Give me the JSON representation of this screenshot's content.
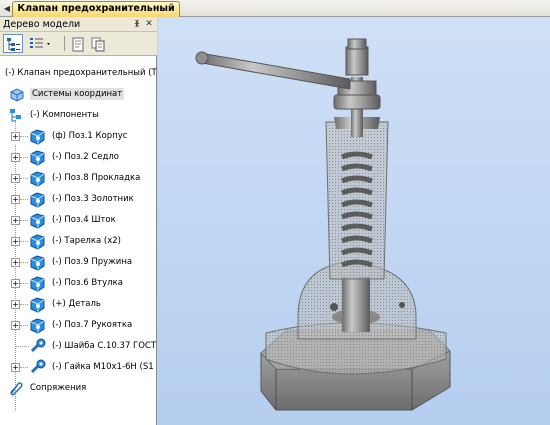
{
  "tabs": {
    "nav_icon": "chevron-left-icon",
    "document": "Клапан предохранительный"
  },
  "panel": {
    "title": "Дерево модели",
    "pin_icon": "pin-icon",
    "close_icon": "close-icon"
  },
  "tree": {
    "root": "(-) Клапан предохранительный (Т",
    "coord_systems": "Системы координат",
    "components": "(-) Компоненты",
    "items": [
      {
        "label": "(ф) Поз.1 Корпус",
        "type": "part"
      },
      {
        "label": "(-) Поз.2 Седло",
        "type": "part"
      },
      {
        "label": "(-) Поз.8 Прокладка",
        "type": "part"
      },
      {
        "label": "(-) Поз.3 Золотник",
        "type": "part"
      },
      {
        "label": "(-) Поз.4 Шток",
        "type": "part"
      },
      {
        "label": "(-) Тарелка (x2)",
        "type": "part"
      },
      {
        "label": "(-) Поз.9 Пружина",
        "type": "part"
      },
      {
        "label": "(-) Поз.6 Втулка",
        "type": "part"
      },
      {
        "label": "(+) Деталь",
        "type": "part"
      },
      {
        "label": "(-) Поз.7 Рукоятка",
        "type": "part"
      },
      {
        "label": "(-) Шайба С.10.37 ГОСТ",
        "type": "standard"
      },
      {
        "label": "(-) Гайка M10x1-6H (S1",
        "type": "standard"
      }
    ],
    "mates": "Сопряжения"
  },
  "colors": {
    "tab_active": "#f5d76e",
    "viewport_bg": "#c4d8f3",
    "part_icon": "#2a8fe0",
    "model_gray": "#9a9a9a"
  }
}
